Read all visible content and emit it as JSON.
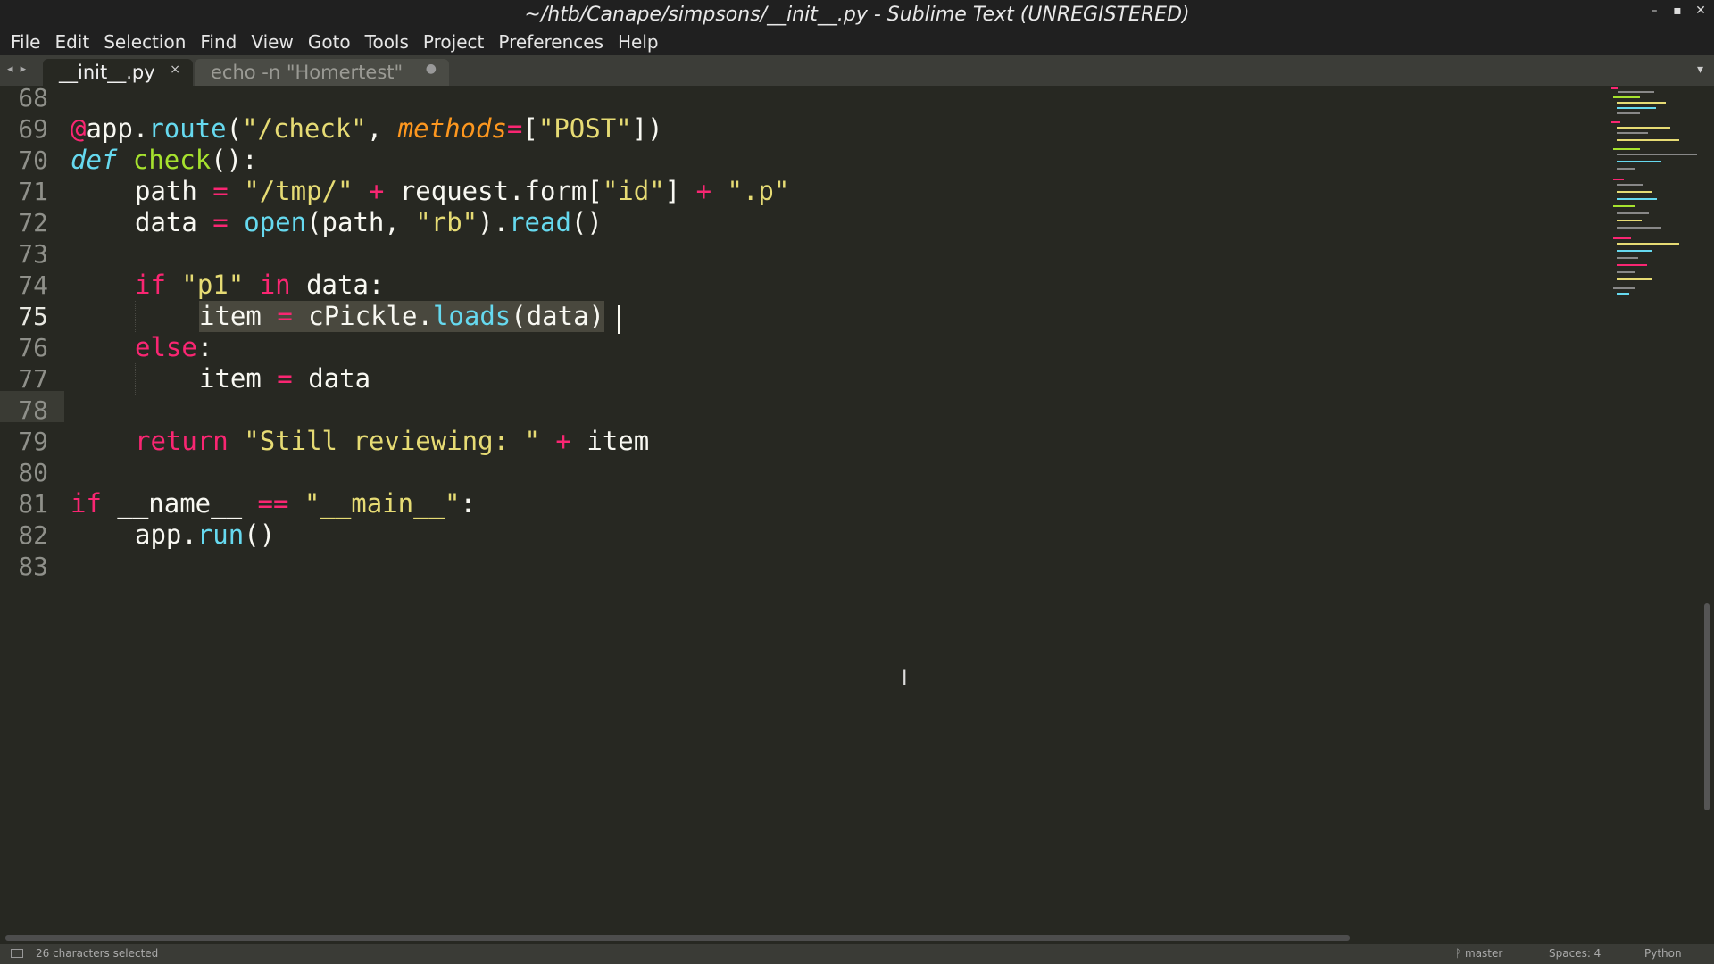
{
  "window": {
    "title": "~/htb/Canape/simpsons/__init__.py - Sublime Text (UNREGISTERED)",
    "controls": [
      "–",
      "▪",
      "✕"
    ]
  },
  "menu": [
    "File",
    "Edit",
    "Selection",
    "Find",
    "View",
    "Goto",
    "Tools",
    "Project",
    "Preferences",
    "Help"
  ],
  "tabs": {
    "nav": "◂ ▸",
    "active": {
      "label": "__init__.py",
      "close": "×"
    },
    "inactive": {
      "label": "echo -n \"Homertest\"",
      "dirty": "●"
    },
    "dropdown": "▾"
  },
  "editor": {
    "line_numbers": [
      "68",
      "69",
      "70",
      "71",
      "72",
      "73",
      "74",
      "75",
      "76",
      "77",
      "78",
      "79",
      "80",
      "81",
      "82",
      "83"
    ],
    "current_line": "75",
    "code": {
      "l69": {
        "at": "@",
        "obj": "app.",
        "fn": "route",
        "p1": "(",
        "s1": "\"/check\"",
        "comma": ", ",
        "param": "methods",
        "eq": "=",
        "rest": "[",
        "s2": "\"POST\"",
        "end": "])"
      },
      "l70": {
        "kw": "def",
        "sp": " ",
        "fn": "check",
        "end": "():"
      },
      "l71": {
        "a": "path",
        "eq": " = ",
        "s1": "\"/tmp/\"",
        "plus1": " + ",
        "b": "request.form[",
        "s2": "\"id\"",
        "c": "] ",
        "plus2": "+ ",
        "s3": "\".p\""
      },
      "l72": {
        "a": "data",
        "eq": " = ",
        "fn": "open",
        "b": "(path, ",
        "s1": "\"rb\"",
        "c": ").",
        "fn2": "read",
        "d": "()"
      },
      "l74": {
        "kw": "if",
        "sp": " ",
        "s1": "\"p1\"",
        "sp2": " ",
        "kw2": "in",
        "rest": " data:"
      },
      "l75": {
        "a": "item",
        "sp": " ",
        "eq": "=",
        "sp2": " ",
        "b": "cPickle.",
        "fn": "loads",
        "c": "(data)"
      },
      "l76": {
        "kw": "else",
        "rest": ":"
      },
      "l77": {
        "a": "item",
        "eq": " = ",
        "b": "data"
      },
      "l79": {
        "kw": "return",
        "sp": " ",
        "s1": "\"Still reviewing: \"",
        "plus": " + ",
        "b": "item"
      },
      "l81": {
        "kw": "if",
        "a": " __name__ ",
        "eq": "==",
        "sp": " ",
        "s1": "\"__main__\"",
        "end": ":"
      },
      "l82": {
        "a": "app.",
        "fn": "run",
        "b": "()"
      }
    },
    "mouse_cursor": "I"
  },
  "status": {
    "selection": "26 characters selected",
    "branch": "ᚹ master",
    "indent": "Spaces: 4",
    "syntax": "Python"
  },
  "colors": {
    "background": "#272822",
    "keyword": "#f92672",
    "function": "#a6e22e",
    "builtin": "#66d9ef",
    "string": "#e6db74",
    "parameter": "#fd971f",
    "text": "#f8f8f2"
  }
}
